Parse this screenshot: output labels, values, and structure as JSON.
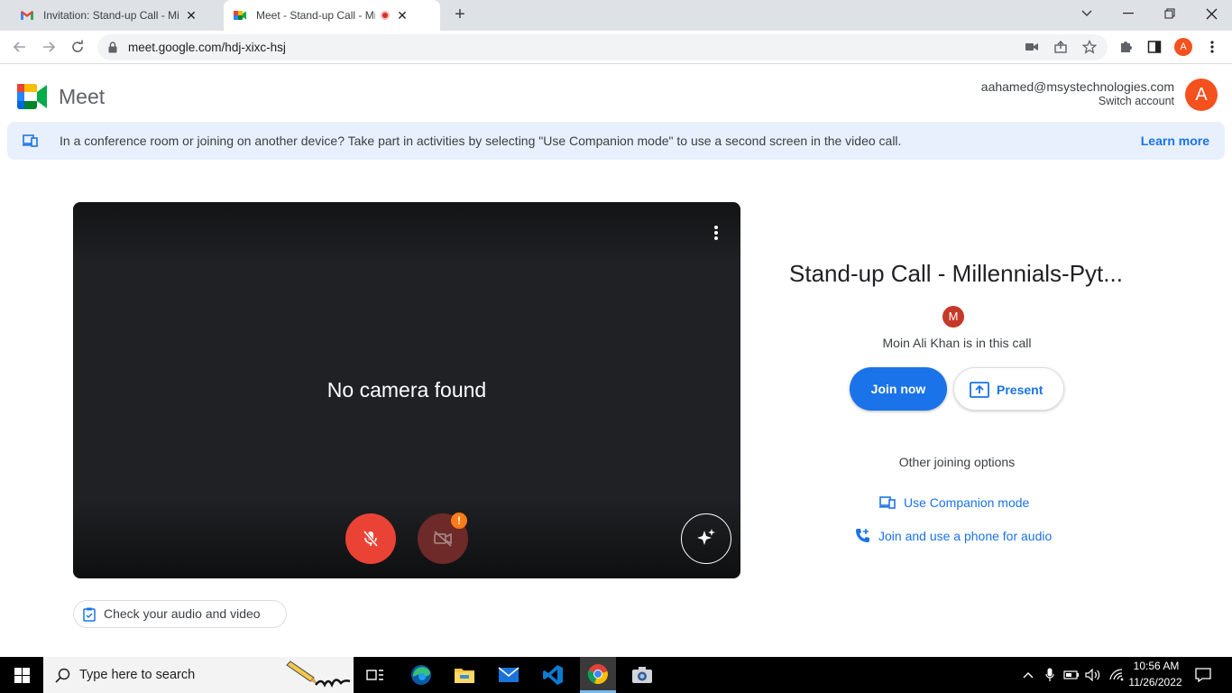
{
  "browser": {
    "tabs": [
      {
        "title": "Invitation: Stand-up Call - Millennials",
        "favicon": "gmail-icon"
      },
      {
        "title": "Meet - Stand-up Call - Millennials",
        "favicon": "meet-icon"
      }
    ],
    "url": "meet.google.com/hdj-xixc-hsj",
    "profile_initial": "A"
  },
  "header": {
    "app_name": "Meet",
    "account_email": "aahamed@msystechnologies.com",
    "switch_account": "Switch account",
    "avatar_initial": "A"
  },
  "banner": {
    "text": "In a conference room or joining on another device? Take part in activities by selecting \"Use Companion mode\" to use a second screen in the video call.",
    "learn_more": "Learn more"
  },
  "preview": {
    "status": "No camera found",
    "camera_warning": "!"
  },
  "check_av": "Check your audio and video",
  "meeting": {
    "title": "Stand-up Call - Millennials-Pyt...",
    "participant_initial": "M",
    "in_call_text": "Moin Ali Khan is in this call",
    "join_label": "Join now",
    "present_label": "Present",
    "other_options": "Other joining options",
    "companion_mode": "Use Companion mode",
    "phone_audio": "Join and use a phone for audio"
  },
  "taskbar": {
    "search_placeholder": "Type here to search",
    "time": "10:56 AM",
    "date": "11/26/2022"
  },
  "colors": {
    "accent": "#1a73e8",
    "mic_off": "#ea4335",
    "avatar": "#f4511e"
  }
}
